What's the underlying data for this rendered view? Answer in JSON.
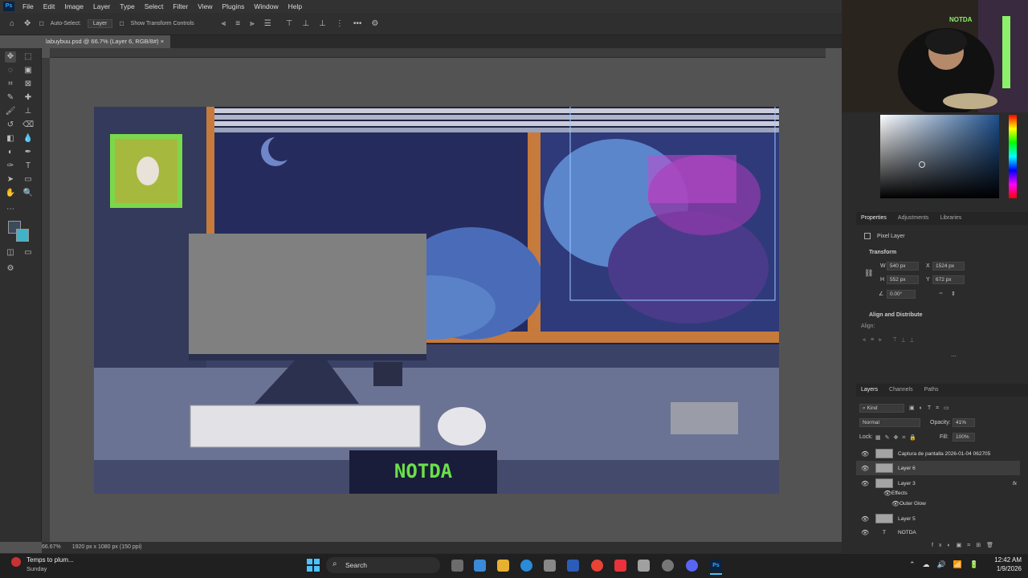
{
  "app": {
    "name": "Ps"
  },
  "menu": [
    "File",
    "Edit",
    "Image",
    "Layer",
    "Type",
    "Select",
    "Filter",
    "View",
    "Plugins",
    "Window",
    "Help"
  ],
  "options_bar": {
    "auto_select_label": "Auto-Select:",
    "auto_select_value": "Layer",
    "transform_controls_label": "Show Transform Controls"
  },
  "document": {
    "tab_title": "labuybuu.psd @ 66.7% (Layer 6, RGB/8#)",
    "zoom": "66.67%",
    "doc_size": "1920 px x 1080 px (150 ppi)"
  },
  "artwork": {
    "keyboard_sign_text": "NOTDA",
    "webcam_sign_text": "NOTDA"
  },
  "properties": {
    "tabs": [
      "Properties",
      "Adjustments",
      "Libraries"
    ],
    "layer_kind": "Pixel Layer",
    "transform_title": "Transform",
    "w_label": "W",
    "w_value": "540 px",
    "h_label": "H",
    "h_value": "552 px",
    "x_label": "X",
    "x_value": "1524 px",
    "y_label": "Y",
    "y_value": "672 px",
    "angle_value": "0.00°",
    "align_title": "Align and Distribute",
    "align_label": "Align:"
  },
  "layers": {
    "tabs": [
      "Layers",
      "Channels",
      "Paths"
    ],
    "filter_kind": "Kind",
    "blend_mode": "Normal",
    "opacity_label": "Opacity:",
    "opacity_value": "41%",
    "lock_label": "Lock:",
    "fill_label": "Fill:",
    "fill_value": "100%",
    "items": [
      {
        "name": "Captura de pantalla 2026-01-04 062705"
      },
      {
        "name": "Layer 6"
      },
      {
        "name": "Layer 3"
      },
      {
        "name": "Effects"
      },
      {
        "name": "Outer Glow"
      },
      {
        "name": "Layer 5"
      },
      {
        "name": "NOTDA"
      }
    ]
  },
  "taskbar": {
    "weather_title": "Temps to plum...",
    "weather_sub": "Sunday",
    "search_label": "Search",
    "time": "12:42 AM",
    "date": "1/9/2026"
  },
  "colors": {
    "accent": "#31a8ff",
    "panel_bg": "#2b2b2b",
    "canvas_bg": "#535353",
    "sign_green": "#6be04a"
  }
}
